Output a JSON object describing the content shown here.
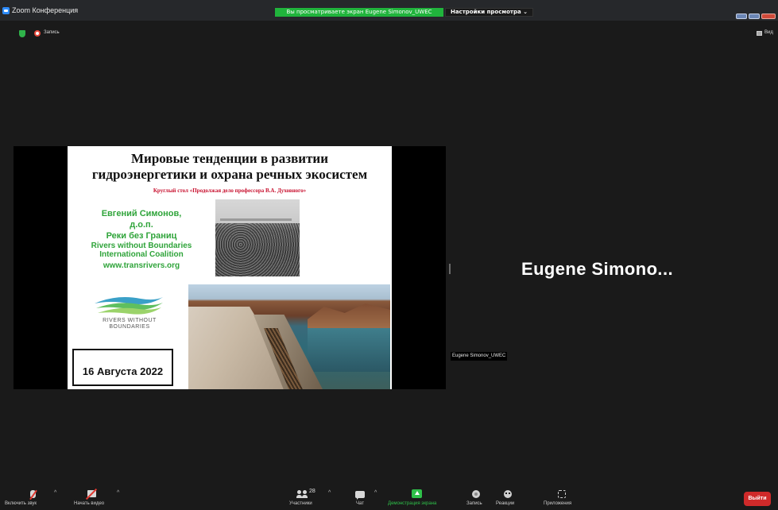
{
  "window": {
    "title": "Zoom Конференция",
    "share_banner": "Вы просматриваете экран Eugene Simonov_UWEC",
    "view_options": "Настройки просмотра ⌄"
  },
  "status": {
    "recording_label": "Запись",
    "view_label": "Вид"
  },
  "slide": {
    "title_line1": "Мировые тенденции в развитии",
    "title_line2": "гидроэнергетики и охрана речных экосистем",
    "subtitle": "Круглый стол «Продолжая дело профессора В.А. Духовного»",
    "author_name": "Евгений Симонов,",
    "author_degree": "д.о.п.",
    "org_ru": "Реки без Границ",
    "org_en_1": "Rivers without Boundaries",
    "org_en_2": "International Coalition",
    "website": "www.transrivers.org",
    "logo_text_1": "RIVERS WITHOUT",
    "logo_text_2": "BOUNDARIES",
    "date": "16 Августа 2022"
  },
  "participant": {
    "display_name": "Eugene  Simono...",
    "name_tag": "Eugene Simonov_UWEC"
  },
  "toolbar": {
    "unmute_label": "Включить звук",
    "start_video_label": "Начать видео",
    "participants_label": "Участники",
    "participants_count": "28",
    "chat_label": "Чат",
    "share_label": "Демонстрация экрана",
    "record_label": "Запись",
    "reactions_label": "Реакции",
    "apps_label": "Приложения",
    "leave_label": "Выйти"
  },
  "colors": {
    "background": "#1a1a1a",
    "share_banner": "#20b43c",
    "slide_green": "#2fa43a",
    "slide_red": "#c8102e",
    "leave_button": "#cf2a2a"
  },
  "icons": [
    "zoom-app-icon",
    "shield-icon",
    "record-icon",
    "view-icon",
    "microphone-muted-icon",
    "camera-off-icon",
    "participants-icon",
    "chat-icon",
    "share-screen-icon",
    "record-icon",
    "reactions-icon",
    "apps-icon"
  ]
}
